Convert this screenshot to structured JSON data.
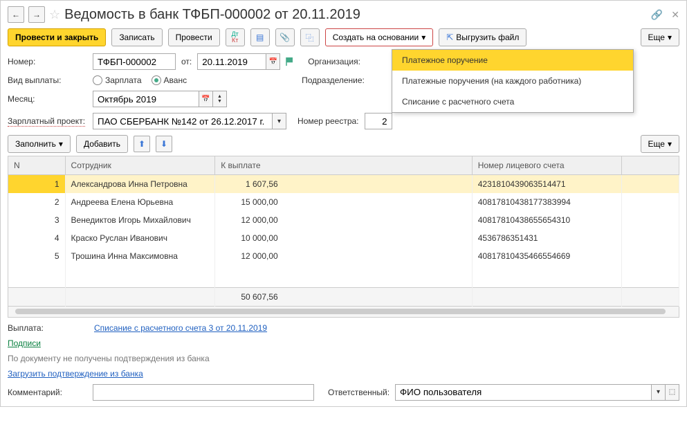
{
  "header": {
    "title": "Ведомость в банк ТФБП-000002 от 20.11.2019"
  },
  "toolbar": {
    "post_close": "Провести и закрыть",
    "write": "Записать",
    "post": "Провести",
    "create_based": "Создать на основании",
    "upload_file": "Выгрузить файл",
    "more": "Еще"
  },
  "dropdown": {
    "item1": "Платежное поручение",
    "item2": "Платежные поручения (на каждого работника)",
    "item3": "Списание с расчетного счета"
  },
  "form": {
    "number_label": "Номер:",
    "number_value": "ТФБП-000002",
    "from_label": "от:",
    "date_value": "20.11.2019",
    "org_label": "Организация:",
    "payment_type_label": "Вид выплаты:",
    "radio_salary": "Зарплата",
    "radio_advance": "Аванс",
    "subdivision_label": "Подразделение:",
    "month_label": "Месяц:",
    "month_value": "Октябрь 2019",
    "salary_project_label": "Зарплатный проект:",
    "salary_project_value": "ПАО СБЕРБАНК №142 от 26.12.2017 г.",
    "registry_number_label": "Номер реестра:",
    "registry_number_value": "2"
  },
  "toolbar2": {
    "fill": "Заполнить",
    "add": "Добавить",
    "more": "Еще"
  },
  "table": {
    "col_n": "N",
    "col_employee": "Сотрудник",
    "col_payout": "К выплате",
    "col_account": "Номер лицевого счета",
    "rows": [
      {
        "n": "1",
        "emp": "Александрова Инна Петровна",
        "pay": "1 607,56",
        "acc": "4231810439063514471"
      },
      {
        "n": "2",
        "emp": "Андреева Елена Юрьевна",
        "pay": "15 000,00",
        "acc": "4081781043817738З994"
      },
      {
        "n": "3",
        "emp": "Венедиктов Игорь Михайлович",
        "pay": "12 000,00",
        "acc": "40817810438655654310"
      },
      {
        "n": "4",
        "emp": "Краско Руслан Иванович",
        "pay": "10 000,00",
        "acc": "4536786351431"
      },
      {
        "n": "5",
        "emp": "Трошина Инна Максимовна",
        "pay": "12 000,00",
        "acc": "40817810435466554669"
      }
    ],
    "total": "50 607,56"
  },
  "footer": {
    "payout_label": "Выплата:",
    "payout_link": "Списание с расчетного счета 3 от 20.11.2019",
    "signatures": "Подписи",
    "bank_status": "По документу не получены подтверждения из банка",
    "load_confirm": "Загрузить подтверждение из банка",
    "comment_label": "Комментарий:",
    "responsible_label": "Ответственный:",
    "responsible_value": "ФИО пользователя"
  }
}
